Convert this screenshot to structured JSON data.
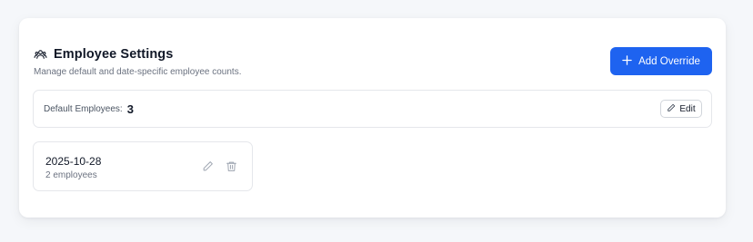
{
  "header": {
    "title": "Employee Settings",
    "subtitle": "Manage default and date-specific employee counts.",
    "add_button_label": "Add Override"
  },
  "defaults": {
    "label": "Default Employees:",
    "value": "3",
    "edit_label": "Edit"
  },
  "overrides": [
    {
      "date": "2025-10-28",
      "count_text": "2 employees"
    }
  ],
  "icons": {
    "title": "users-icon",
    "add": "plus-icon",
    "edit": "pencil-icon",
    "delete": "trash-icon"
  },
  "colors": {
    "primary": "#1e63f0",
    "background": "#f5f7fa",
    "card": "#ffffff",
    "border": "#e5e7eb"
  }
}
